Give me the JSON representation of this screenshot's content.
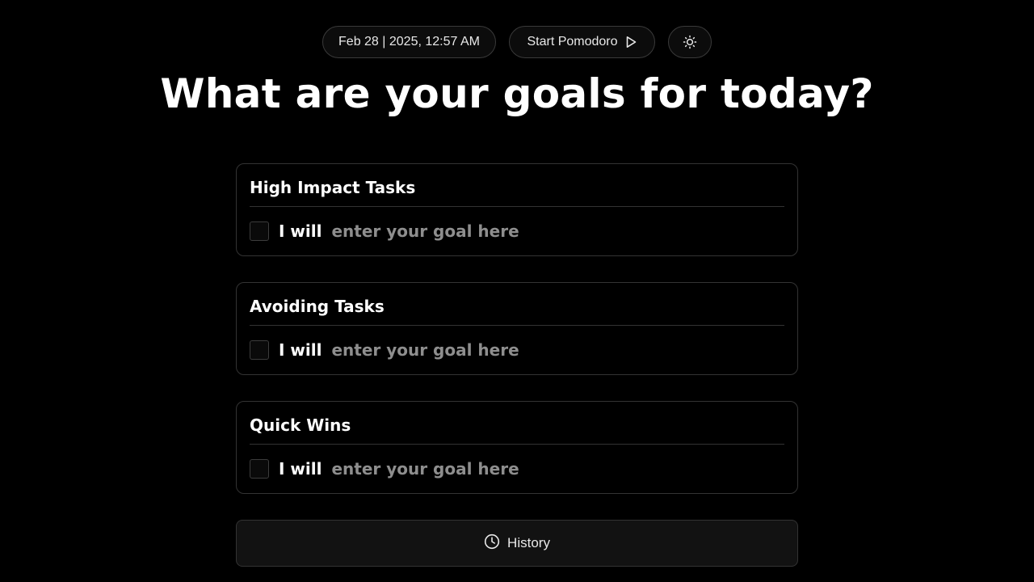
{
  "header": {
    "datetime": "Feb 28 | 2025, 12:57 AM",
    "pomodoro_label": "Start Pomodoro",
    "pomodoro_icon": "play-icon",
    "theme_icon": "sun-icon"
  },
  "headline": "What are your goals for today?",
  "sections": [
    {
      "title": "High Impact Tasks",
      "prefix": "I will",
      "placeholder": "enter your goal here",
      "value": "",
      "checked": false
    },
    {
      "title": "Avoiding Tasks",
      "prefix": "I will",
      "placeholder": "enter your goal here",
      "value": "",
      "checked": false
    },
    {
      "title": "Quick Wins",
      "prefix": "I will",
      "placeholder": "enter your goal here",
      "value": "",
      "checked": false
    }
  ],
  "history": {
    "label": "History",
    "icon": "clock-icon"
  },
  "colors": {
    "background": "#000000",
    "text": "#ffffff",
    "muted": "#8e8e8e",
    "border": "#333333"
  }
}
